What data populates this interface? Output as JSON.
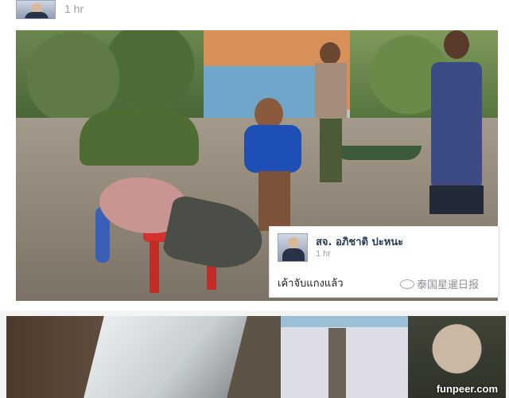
{
  "header": {
    "time": "1 hr"
  },
  "comment": {
    "author_name": "สจ. อภิชาติ ปะหนะ",
    "time": "1 hr",
    "text": "เค้าจับแกงแล้ว",
    "watermark": "泰国星暹日报"
  },
  "footer": {
    "site_watermark": "funpeer.com"
  },
  "colors": {
    "author_name": "#2d3a55",
    "timestamp": "#9aa0a8"
  }
}
